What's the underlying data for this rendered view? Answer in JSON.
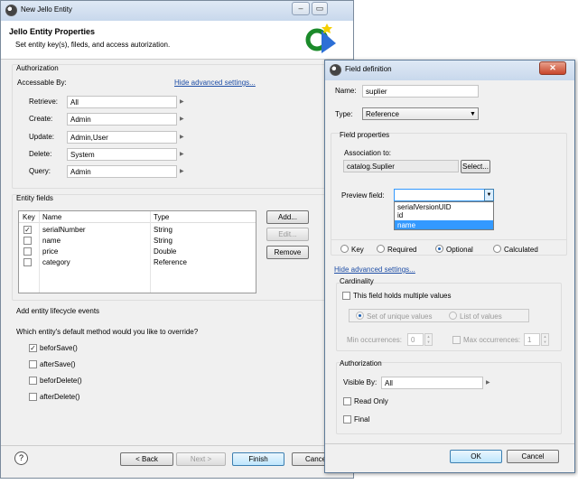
{
  "main": {
    "title": "New Jello Entity",
    "header_title": "Jello Entity Properties",
    "header_sub": "Set entity key(s), fileds, and access autorization.",
    "auth_heading": "Authorization",
    "accessable_by": "Accessable By:",
    "hide_link": "Hide advanced settings...",
    "access_rows": [
      {
        "label": "Retrieve:",
        "value": "All"
      },
      {
        "label": "Create:",
        "value": "Admin"
      },
      {
        "label": "Update:",
        "value": "Admin,User"
      },
      {
        "label": "Delete:",
        "value": "System"
      },
      {
        "label": "Query:",
        "value": "Admin"
      }
    ],
    "fields_heading": "Entity fields",
    "table_headers": [
      "Key",
      "Name",
      "Type"
    ],
    "fields": [
      {
        "key": true,
        "name": "serialNumber",
        "type": "String"
      },
      {
        "key": false,
        "name": "name",
        "type": "String"
      },
      {
        "key": false,
        "name": "price",
        "type": "Double"
      },
      {
        "key": false,
        "name": "category",
        "type": "Reference"
      }
    ],
    "add_btn": "Add...",
    "edit_btn": "Edit...",
    "remove_btn": "Remove",
    "lifecycle_heading": "Add entity lifecycle events",
    "override_q": "Which entity's default method would you like to override?",
    "events": [
      {
        "label": "beforSave()",
        "checked": true
      },
      {
        "label": "afterSave()",
        "checked": false
      },
      {
        "label": "beforDelete()",
        "checked": false
      },
      {
        "label": "afterDelete()",
        "checked": false
      }
    ],
    "back_btn": "< Back",
    "next_btn": "Next >",
    "finish_btn": "Finish",
    "cancel_btn": "Cancel"
  },
  "field": {
    "title": "Field definition",
    "name_label": "Name:",
    "name_value": "suplier",
    "type_label": "Type:",
    "type_value": "Reference",
    "props_heading": "Field properties",
    "assoc_label": "Association to:",
    "assoc_value": "catalog.Suplier",
    "select_btn": "Select...",
    "preview_label": "Preview field:",
    "preview_options": [
      "serialVersionUID",
      "id",
      "name"
    ],
    "preview_selected": "name",
    "radios": [
      {
        "label": "Key",
        "on": false
      },
      {
        "label": "Required",
        "on": false
      },
      {
        "label": "Optional",
        "on": true
      },
      {
        "label": "Calculated",
        "on": false
      }
    ],
    "hide_link": "Hide advanced settings...",
    "card_heading": "Cardinality",
    "multi_label": "This field holds multiple values",
    "set_unique": "Set of unique values",
    "list_values": "List of values",
    "min_label": "Min occurrences:",
    "min_value": "0",
    "max_label": "Max occurrences:",
    "max_value": "1",
    "auth_heading": "Authorization",
    "visible_label": "Visible By:",
    "visible_value": "All",
    "readonly": "Read Only",
    "final": "Final",
    "ok_btn": "OK",
    "cancel_btn": "Cancel"
  },
  "colors": {
    "accent": "#3399ff",
    "link": "#1f4ea6",
    "titlebar": "#c8d8ec",
    "close": "#c8452b"
  }
}
